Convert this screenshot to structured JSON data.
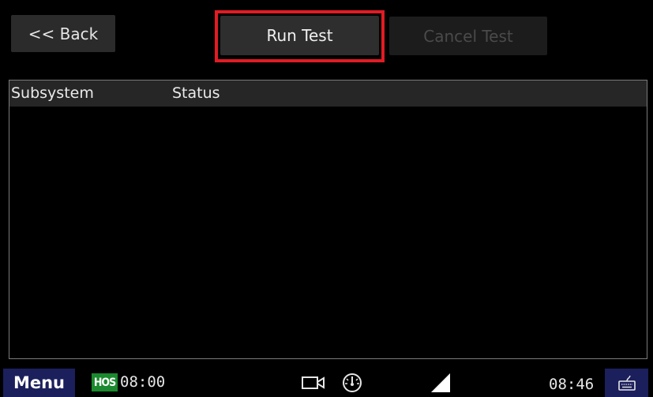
{
  "toolbar": {
    "back_label": "<< Back",
    "run_label": "Run Test",
    "cancel_label": "Cancel Test"
  },
  "table": {
    "columns": [
      "Subsystem",
      "Status"
    ],
    "rows": []
  },
  "status_bar": {
    "menu_label": "Menu",
    "hos_badge": "HOS",
    "hos_time": "08:00",
    "clock": "08:46",
    "icons": [
      "camera-icon",
      "gauge-icon",
      "signal-icon",
      "keyboard-icon"
    ]
  },
  "colors": {
    "highlight": "#e21b23",
    "menu_bg": "#1b1f5c",
    "hos_bg": "#1b8a2e"
  }
}
